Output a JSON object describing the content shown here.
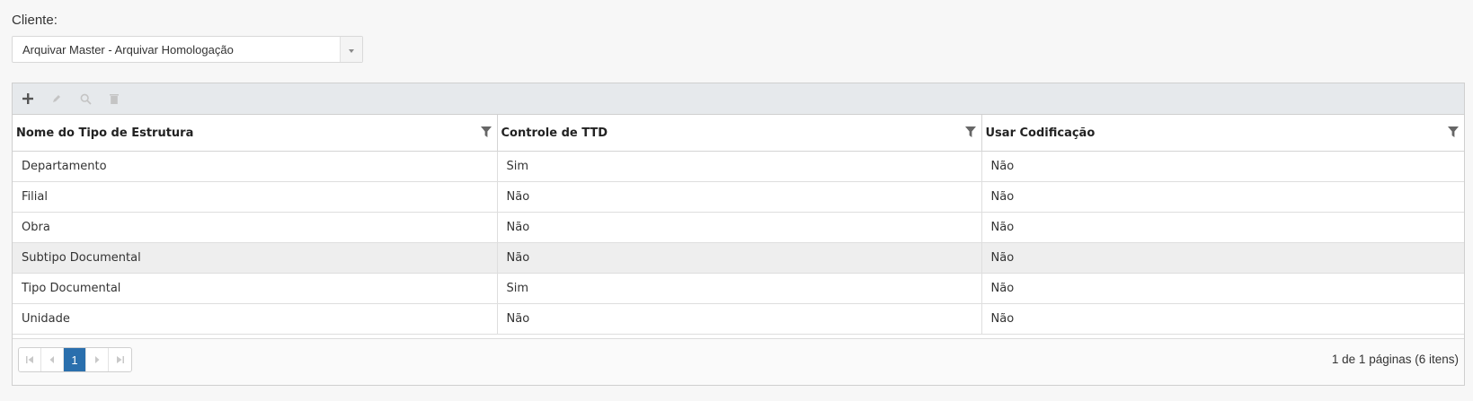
{
  "client": {
    "label": "Cliente:",
    "selected": "Arquivar Master - Arquivar Homologação"
  },
  "toolbar": {
    "buttons": [
      "add-icon",
      "edit-icon",
      "search-icon",
      "delete-icon"
    ]
  },
  "table": {
    "columns": [
      "Nome do Tipo de Estrutura",
      "Controle de TTD",
      "Usar Codificação"
    ],
    "rows": [
      [
        "Departamento",
        "Sim",
        "Não"
      ],
      [
        "Filial",
        "Não",
        "Não"
      ],
      [
        "Obra",
        "Não",
        "Não"
      ],
      [
        "Subtipo Documental",
        "Não",
        "Não"
      ],
      [
        "Tipo Documental",
        "Sim",
        "Não"
      ],
      [
        "Unidade",
        "Não",
        "Não"
      ]
    ],
    "highlighted_row": 3
  },
  "pager": {
    "current_page": "1",
    "info": "1 de 1 páginas (6 itens)"
  },
  "colors": {
    "active_page": "#2a6fad",
    "toolbar_bg": "#e6e9ec"
  }
}
